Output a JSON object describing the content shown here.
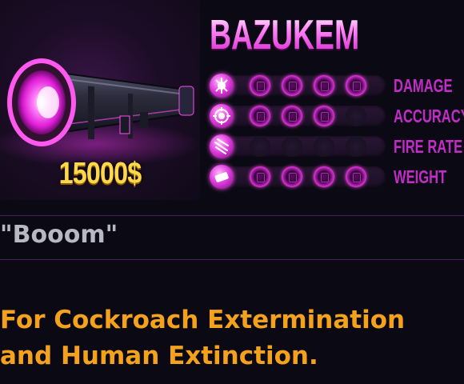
{
  "weapon": {
    "name": "BAZUKEM",
    "price": "15000$",
    "image_icon": "bazooka-image",
    "quote": "\"Booom\"",
    "description_lines": [
      "For Cockroach Extermination",
      "and Human Extinction."
    ]
  },
  "stats": [
    {
      "label": "DAMAGE",
      "icon": "explosion-icon",
      "level": 4,
      "max": 4
    },
    {
      "label": "ACCURACY",
      "icon": "crosshair-icon",
      "level": 3,
      "max": 4
    },
    {
      "label": "FIRE RATE",
      "icon": "projectiles-icon",
      "level": 0,
      "max": 4
    },
    {
      "label": "WEIGHT",
      "icon": "weight-icon",
      "level": 4,
      "max": 4
    }
  ],
  "colors": {
    "accent": "#ff4cf2",
    "stat_label": "#c22cc6",
    "price": "#ffd84a",
    "description": "#f4a21c",
    "quote": "#b8b8c4",
    "background": "#0b0a14"
  }
}
